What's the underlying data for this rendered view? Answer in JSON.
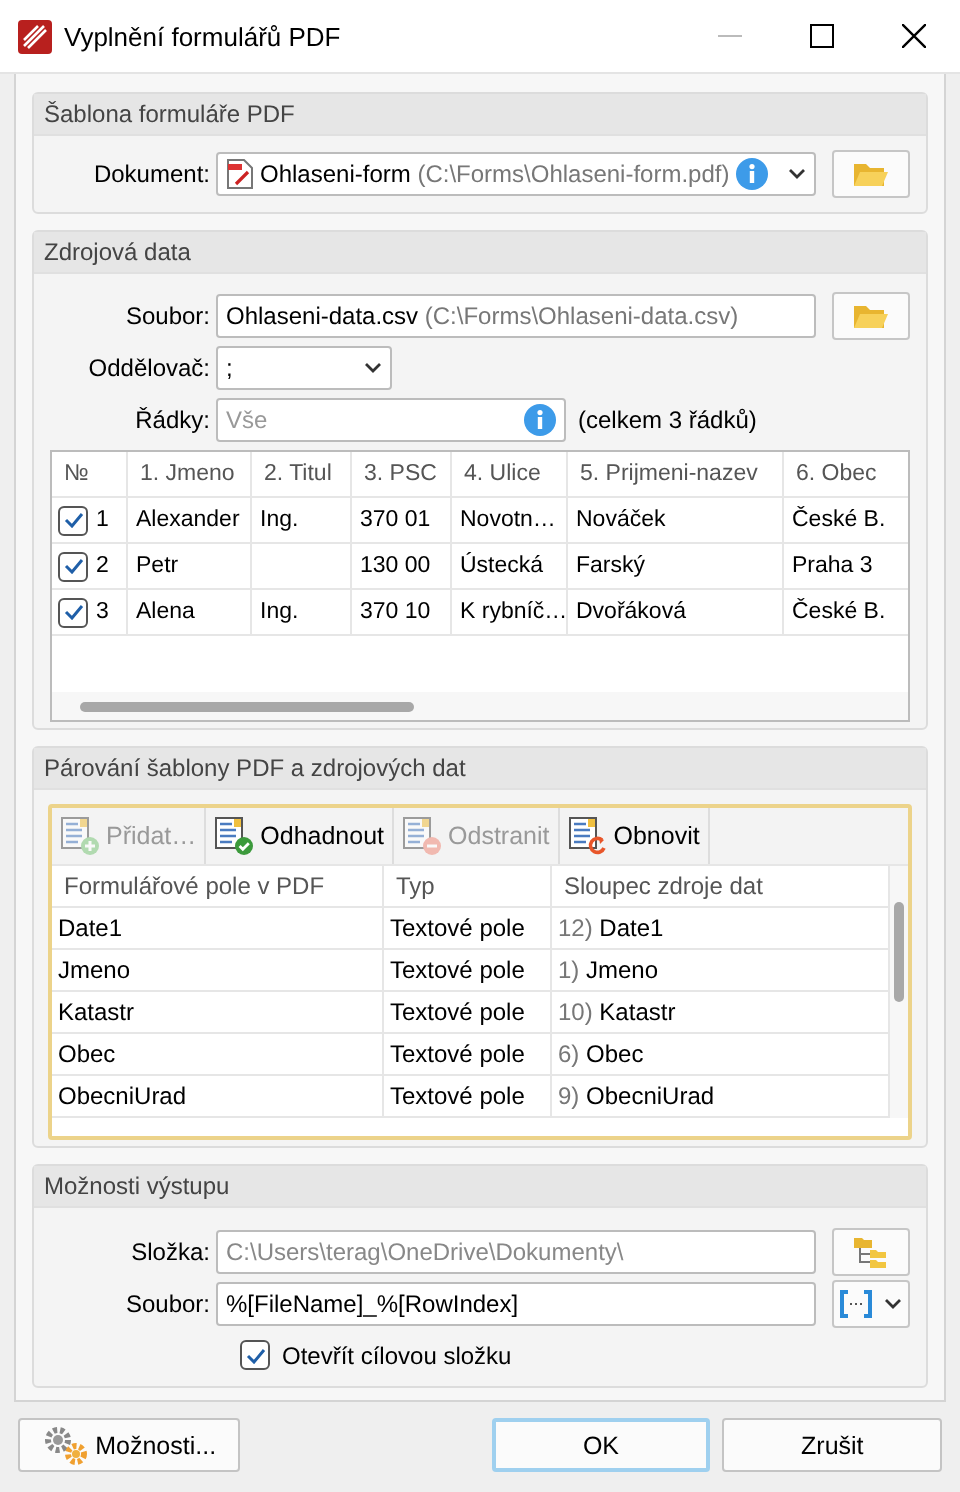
{
  "window": {
    "title": "Vyplnění formulářů PDF"
  },
  "template": {
    "title": "Šablona formuláře PDF",
    "document": {
      "label": "Dokument:",
      "name": "Ohlaseni-form",
      "path": "(C:\\Forms\\Ohlaseni-form.pdf)"
    }
  },
  "source": {
    "title": "Zdrojová data",
    "file": {
      "label": "Soubor:",
      "name": "Ohlaseni-data.csv",
      "path": "(C:\\Forms\\Ohlaseni-data.csv)"
    },
    "delimiter": {
      "label": "Oddělovač:",
      "value": ";"
    },
    "rows": {
      "label": "Řádky:",
      "placeholder": "Vše",
      "note": "(celkem 3 řádků)"
    },
    "table": {
      "columns": [
        "№",
        "1. Jmeno",
        "2. Titul",
        "3. PSC",
        "4. Ulice",
        "5. Prijmeni-nazev",
        "6. Obec"
      ],
      "rows": [
        {
          "checked": true,
          "cells": [
            "1",
            "Alexander",
            "Ing.",
            "370 01",
            "Novotn…",
            "Nováček",
            "České B."
          ]
        },
        {
          "checked": true,
          "cells": [
            "2",
            "Petr",
            "",
            "130 00",
            "Ústecká",
            "Farský",
            "Praha 3"
          ]
        },
        {
          "checked": true,
          "cells": [
            "3",
            "Alena",
            "Ing.",
            "370 10",
            "K rybníč…",
            "Dvořáková",
            "České B."
          ]
        }
      ]
    }
  },
  "mapping": {
    "title": "Párování šablony PDF a zdrojových dat",
    "toolbar": [
      {
        "kind": "add",
        "label": "Přidat…",
        "disabled": true
      },
      {
        "kind": "guess",
        "label": "Odhadnout",
        "disabled": false
      },
      {
        "kind": "remove",
        "label": "Odstranit",
        "disabled": true
      },
      {
        "kind": "refresh",
        "label": "Obnovit",
        "disabled": false
      }
    ],
    "columns": [
      "Formulářové pole v PDF",
      "Typ",
      "Sloupec zdroje dat"
    ],
    "rows": [
      {
        "field": "Date1",
        "type": "Textové pole",
        "index": "12)",
        "column": "Date1"
      },
      {
        "field": "Jmeno",
        "type": "Textové pole",
        "index": "1)",
        "column": "Jmeno"
      },
      {
        "field": "Katastr",
        "type": "Textové pole",
        "index": "10)",
        "column": "Katastr"
      },
      {
        "field": "Obec",
        "type": "Textové pole",
        "index": "6)",
        "column": "Obec"
      },
      {
        "field": "ObecniUrad",
        "type": "Textové pole",
        "index": "9)",
        "column": "ObecniUrad"
      }
    ]
  },
  "output": {
    "title": "Možnosti výstupu",
    "folder": {
      "label": "Složka:",
      "placeholder": "C:\\Users\\terag\\OneDrive\\Dokumenty\\"
    },
    "file": {
      "label": "Soubor:",
      "value": "%[FileName]_%[RowIndex]"
    },
    "open_folder": {
      "label": "Otevřít cílovou složku",
      "checked": true
    }
  },
  "buttons": [
    {
      "kind": "options",
      "label": "Možnosti...",
      "default": false
    },
    {
      "kind": "ok",
      "label": "OK",
      "default": true
    },
    {
      "kind": "cancel",
      "label": "Zrušit",
      "default": false
    }
  ]
}
